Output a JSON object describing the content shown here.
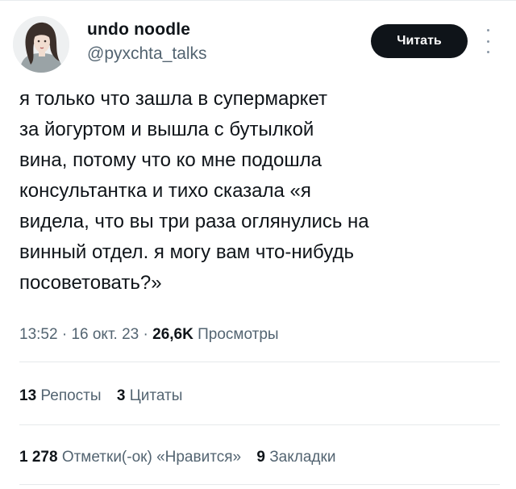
{
  "user": {
    "display_name": "undo noodle",
    "handle": "@pyxchta_talks",
    "avatar_icon": "illustrated-portrait-avatar"
  },
  "actions": {
    "follow_label": "Читать",
    "more_icon": "more-vertical-icon"
  },
  "tweet": {
    "lines": [
      "я только что зашла в супермаркет",
      "за йогуртом и вышла с бутылкой",
      "вина, потому что ко мне подошла",
      "консультантка и тихо сказала «я",
      "видела, что вы три раза оглянулись на",
      "винный отдел. я могу вам что-нибудь",
      "посоветовать?»"
    ]
  },
  "meta": {
    "time": "13:52",
    "date": "16 окт. 23",
    "views_count": "26,6K",
    "views_label": "Просмотры"
  },
  "stats": {
    "reposts_count": "13",
    "reposts_label": "Репосты",
    "quotes_count": "3",
    "quotes_label": "Цитаты",
    "likes_count": "1 278",
    "likes_label": "Отметки(-ок) «Нравится»",
    "bookmarks_count": "9",
    "bookmarks_label": "Закладки"
  }
}
